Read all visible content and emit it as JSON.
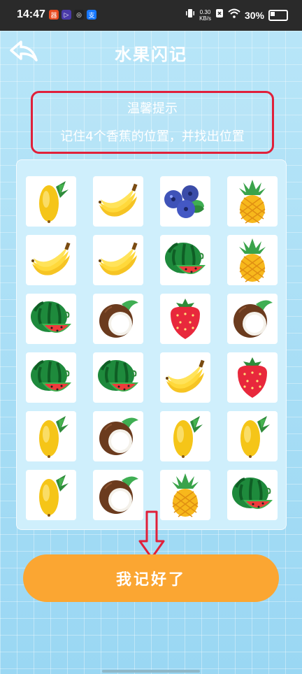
{
  "status_bar": {
    "time": "14:47",
    "net_speed_value": "0.30",
    "net_speed_unit": "KB/s",
    "battery": "30%",
    "app_icons": [
      {
        "label": "器",
        "color": "#e94a1f"
      },
      {
        "label": "▷",
        "color": "#4a3aa8"
      },
      {
        "label": "◎",
        "color": "#222222"
      },
      {
        "label": "支",
        "color": "#1677ff"
      }
    ]
  },
  "header": {
    "title": "水果闪记"
  },
  "tip": {
    "title": "温馨提示",
    "text": "记住4个香蕉的位置，并找出位置"
  },
  "grid": [
    [
      "mango",
      "banana",
      "blueberry",
      "pineapple"
    ],
    [
      "banana",
      "banana",
      "watermelon",
      "pineapple"
    ],
    [
      "watermelon",
      "coconut",
      "strawberry",
      "coconut"
    ],
    [
      "watermelon",
      "watermelon",
      "banana",
      "strawberry"
    ],
    [
      "mango",
      "coconut",
      "mango",
      "mango"
    ],
    [
      "mango",
      "coconut",
      "pineapple",
      "watermelon"
    ]
  ],
  "confirm_button": {
    "label": "我记好了"
  },
  "colors": {
    "accent": "#fba632",
    "highlight": "#e0203a"
  }
}
